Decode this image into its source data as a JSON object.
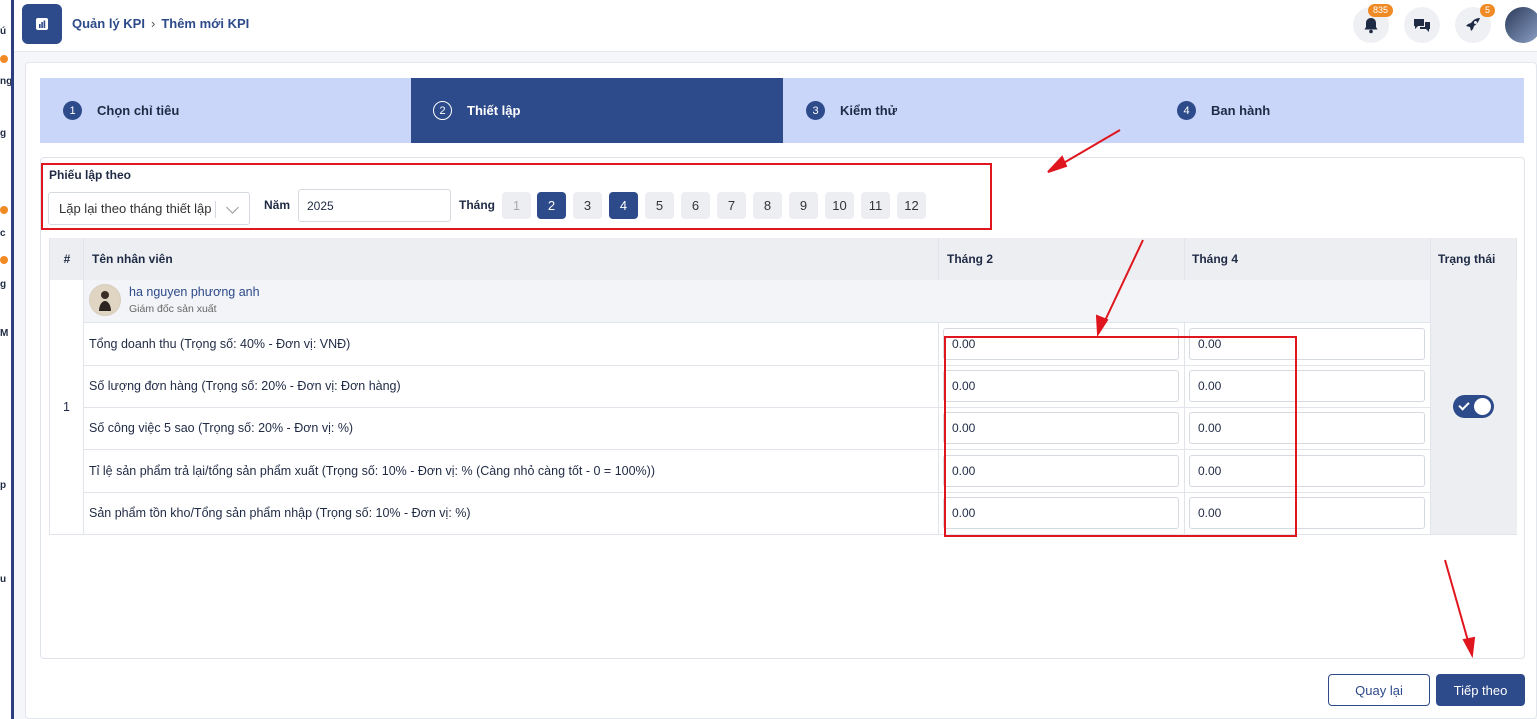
{
  "sidebar": {
    "fragments": [
      "ú",
      "ng",
      "g",
      "c",
      "g",
      "M",
      "p",
      "u"
    ]
  },
  "header": {
    "breadcrumb": [
      "Quản lý KPI",
      "Thêm mới KPI"
    ],
    "notifications_count": "835",
    "rocket_count": "5"
  },
  "steps": [
    {
      "num": "1",
      "label": "Chọn chỉ tiêu"
    },
    {
      "num": "2",
      "label": "Thiết lập"
    },
    {
      "num": "3",
      "label": "Kiểm thử"
    },
    {
      "num": "4",
      "label": "Ban hành"
    }
  ],
  "filter": {
    "title": "Phiếu lập theo",
    "repeat_select": "Lặp lại theo tháng thiết lập",
    "year_label": "Năm",
    "year_value": "2025",
    "month_label": "Tháng",
    "months": [
      "1",
      "2",
      "3",
      "4",
      "5",
      "6",
      "7",
      "8",
      "9",
      "10",
      "11",
      "12"
    ],
    "selected_months": [
      "2",
      "4"
    ],
    "disabled_months": [
      "1"
    ]
  },
  "table": {
    "headers": {
      "index": "#",
      "employee": "Tên nhân viên",
      "col1": "Tháng 2",
      "col2": "Tháng 4",
      "status": "Trạng thái"
    },
    "row_index": "1",
    "employee": {
      "name": "ha nguyen phương anh",
      "title": "Giám đốc sản xuất"
    },
    "kpis": [
      {
        "name": "Tổng doanh thu (Trọng số: 40% - Đơn vị: VNĐ)",
        "m2": "0.00",
        "m4": "0.00"
      },
      {
        "name": "Số lượng đơn hàng (Trọng số: 20% - Đơn vị: Đơn hàng)",
        "m2": "0.00",
        "m4": "0.00"
      },
      {
        "name": "Số công việc 5 sao (Trọng số: 20% - Đơn vị: %)",
        "m2": "0.00",
        "m4": "0.00"
      },
      {
        "name": "Tỉ lệ sản phẩm trả lại/tổng sản phẩm xuất (Trọng số: 10% - Đơn vị: % (Càng nhỏ càng tốt - 0 = 100%))",
        "m2": "0.00",
        "m4": "0.00"
      },
      {
        "name": "Sản phẩm tồn kho/Tổng sản phẩm nhập (Trọng số: 10% - Đơn vị: %)",
        "m2": "0.00",
        "m4": "0.00"
      }
    ],
    "status_enabled": true
  },
  "footer": {
    "back_label": "Quay lại",
    "next_label": "Tiếp theo"
  },
  "colors": {
    "primary": "#2d4a8a",
    "step_inactive": "#c9d6fa",
    "annotation": "#e0161e",
    "badge": "#f08a24"
  }
}
